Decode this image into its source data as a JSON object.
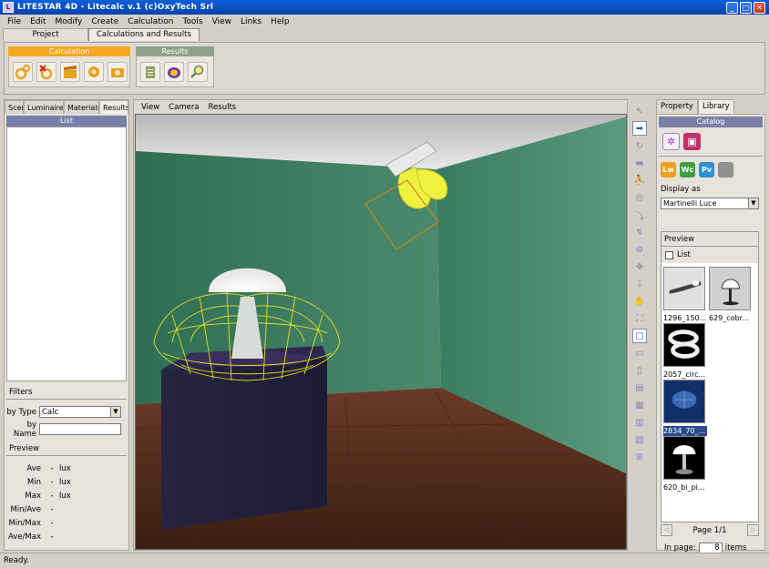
{
  "window": {
    "app_icon": "litestar-icon",
    "title": "LITESTAR 4D - Litecalc v.1    (c)OxyTech Srl",
    "min_glyph": "_",
    "max_glyph": "□",
    "close_glyph": "✕"
  },
  "menu": [
    "File",
    "Edit",
    "Modify",
    "Create",
    "Calculation",
    "Tools",
    "View",
    "Links",
    "Help"
  ],
  "main_tabs": [
    "Project",
    "Calculations and Results"
  ],
  "ribbon": {
    "calculation_label": "Calculation",
    "results_label": "Results",
    "calculation_color": "#f5a623",
    "results_color": "#8ea38a"
  },
  "left": {
    "tabs": [
      "Scen",
      "Luminaires",
      "Materials",
      "Results"
    ],
    "list_header": "List",
    "filters_label": "Filters",
    "by_type_label": "by Type",
    "by_type_value": "Calc",
    "by_name_label": "by Name",
    "preview_label": "Preview",
    "stats": [
      {
        "k": "Ave",
        "v": "-",
        "u": "lux"
      },
      {
        "k": "Min",
        "v": "-",
        "u": "lux"
      },
      {
        "k": "Max",
        "v": "-",
        "u": "lux"
      },
      {
        "k": "Min/Ave",
        "v": "-",
        "u": ""
      },
      {
        "k": "Min/Max",
        "v": "-",
        "u": ""
      },
      {
        "k": "Ave/Max",
        "v": "-",
        "u": ""
      }
    ]
  },
  "view_menu": [
    "View",
    "Camera",
    "Results"
  ],
  "right": {
    "tabs": [
      "Property",
      "Library"
    ],
    "catalog_header": "Catalog",
    "formats": [
      "Lw",
      "Wc",
      "Pv",
      ""
    ],
    "display_as_label": "Display as",
    "display_as_value": "Martinelli Luce",
    "preview_label": "Preview",
    "list_checkbox_label": "List",
    "thumbs": [
      "1296_150...",
      "629_cobr...",
      "2057_circ...",
      "2834_70_...",
      "620_bi_pi..."
    ],
    "page_label": "Page 1/1",
    "in_page_label": "In page:",
    "in_page_value": "8",
    "items_label": "items"
  },
  "status": "Ready."
}
